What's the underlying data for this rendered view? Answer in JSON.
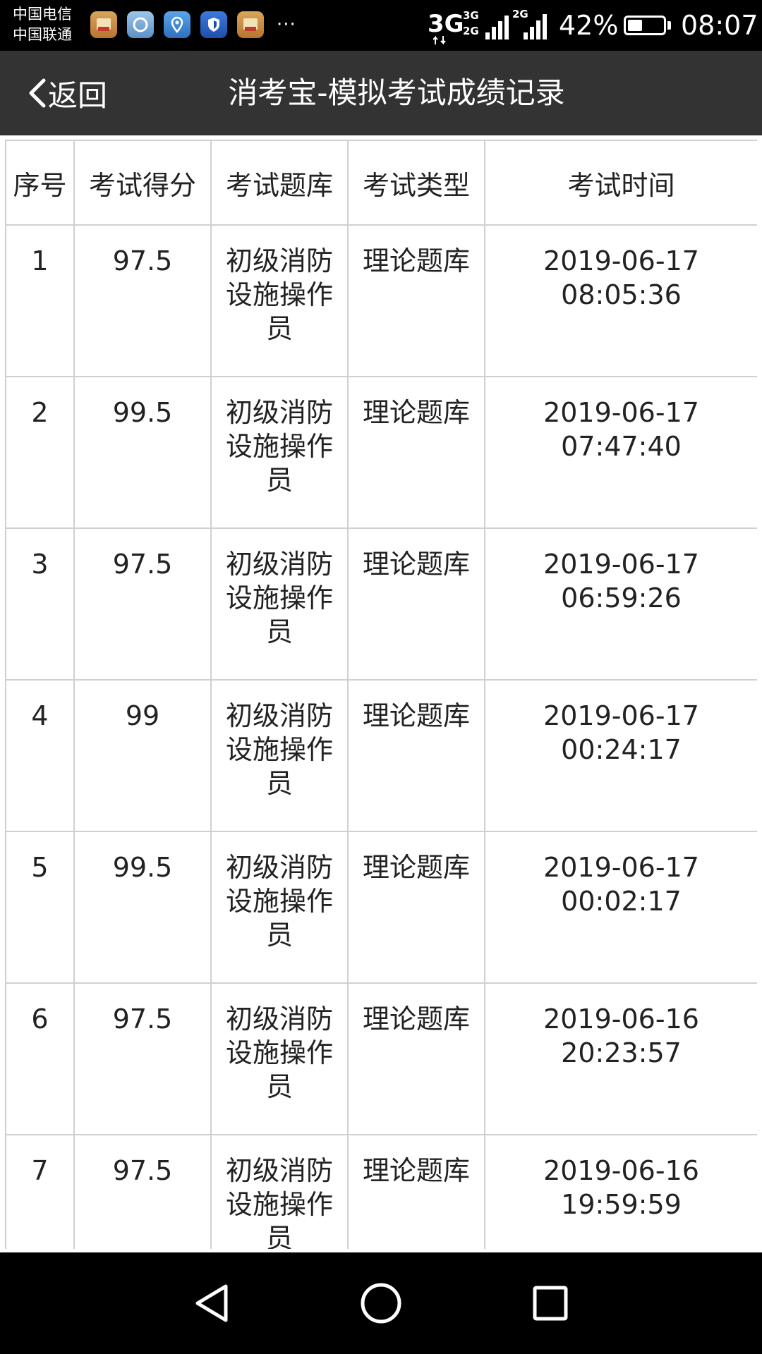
{
  "status_bar": {
    "carrier_1": "中国电信",
    "carrier_2": "中国联通",
    "more": "···",
    "net_1": "3G",
    "net_2_top": "3G",
    "net_2_bottom": "2G",
    "net_3": "2G",
    "battery_percent": "42%",
    "battery_level": 0.42,
    "time": "08:07",
    "icons": [
      "app-icon-1",
      "app-icon-2",
      "location-app-icon",
      "shield-app-icon",
      "app-icon-5"
    ]
  },
  "header": {
    "back_label": "返回",
    "title": "消考宝-模拟考试成绩记录",
    "background": "#333333"
  },
  "table": {
    "headers": [
      "序号",
      "考试得分",
      "考试题库",
      "考试类型",
      "考试时间"
    ],
    "rows": [
      {
        "index": "1",
        "score": "97.5",
        "bank": "初级消防设施操作员",
        "type": "理论题库",
        "time": "2019-06-17\n08:05:36"
      },
      {
        "index": "2",
        "score": "99.5",
        "bank": "初级消防设施操作员",
        "type": "理论题库",
        "time": "2019-06-17\n07:47:40"
      },
      {
        "index": "3",
        "score": "97.5",
        "bank": "初级消防设施操作员",
        "type": "理论题库",
        "time": "2019-06-17\n06:59:26"
      },
      {
        "index": "4",
        "score": "99",
        "bank": "初级消防设施操作员",
        "type": "理论题库",
        "time": "2019-06-17\n00:24:17"
      },
      {
        "index": "5",
        "score": "99.5",
        "bank": "初级消防设施操作员",
        "type": "理论题库",
        "time": "2019-06-17\n00:02:17"
      },
      {
        "index": "6",
        "score": "97.5",
        "bank": "初级消防设施操作员",
        "type": "理论题库",
        "time": "2019-06-16\n20:23:57"
      },
      {
        "index": "7",
        "score": "97.5",
        "bank": "初级消防设施操作员",
        "type": "理论题库",
        "time": "2019-06-16\n19:59:59"
      }
    ]
  },
  "nav_bar": {
    "buttons": [
      "back-triangle-icon",
      "home-circle-icon",
      "recents-square-icon"
    ]
  }
}
